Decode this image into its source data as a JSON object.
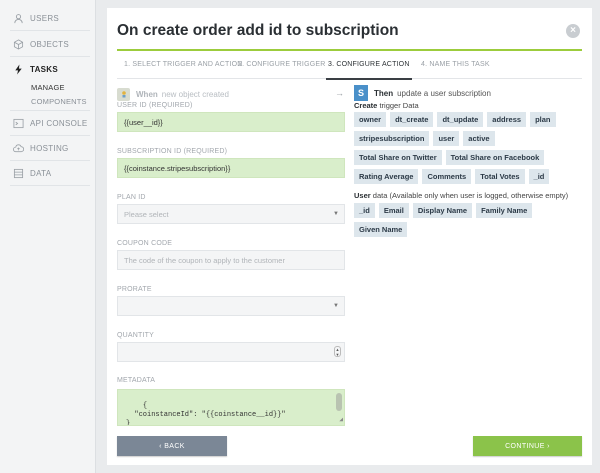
{
  "sidebar": {
    "items": [
      {
        "label": "USERS",
        "icon": "users-icon"
      },
      {
        "label": "OBJECTS",
        "icon": "cube-icon"
      },
      {
        "label": "TASKS",
        "icon": "lightning-icon"
      },
      {
        "label": "API CONSOLE",
        "icon": "terminal-icon"
      },
      {
        "label": "HOSTING",
        "icon": "cloud-icon"
      },
      {
        "label": "DATA",
        "icon": "database-icon"
      }
    ],
    "sub_items": [
      "MANAGE",
      "COMPONENTS"
    ]
  },
  "modal": {
    "title": "On create order add id to subscription",
    "close_icon": "×",
    "steps": [
      "1. SELECT TRIGGER AND ACTION",
      "2. CONFIGURE TRIGGER",
      "3. CONFIGURE ACTION",
      "4. NAME THIS TASK"
    ],
    "active_step": 2
  },
  "when": {
    "word": "When",
    "text": "new object created",
    "arrow": "→"
  },
  "form": {
    "user_id": {
      "label": "USER ID (REQUIRED)",
      "value": "{{user__id}}"
    },
    "subscription_id": {
      "label": "SUBSCRIPTION ID (REQUIRED)",
      "value": "{{coinstance.stripesubscription}}"
    },
    "plan_id": {
      "label": "PLAN ID",
      "value": "Please select"
    },
    "coupon_code": {
      "label": "COUPON CODE",
      "placeholder": "The code of the coupon to apply to the customer"
    },
    "prorate": {
      "label": "PRORATE",
      "value": ""
    },
    "quantity": {
      "label": "QUANTITY",
      "value": ""
    },
    "metadata": {
      "label": "METADATA",
      "value": "{\n  \"coinstanceId\": \"{{coinstance__id}}\"\n}"
    }
  },
  "then": {
    "icon_letter": "S",
    "word": "Then",
    "text": "update a user subscription"
  },
  "create_section": {
    "bold": "Create",
    "rest": " trigger Data",
    "tags": [
      "owner",
      "dt_create",
      "dt_update",
      "address",
      "plan",
      "stripesubscription",
      "user",
      "active",
      "Total Share on Twitter",
      "Total Share on Facebook",
      "Rating Average",
      "Comments",
      "Total Votes",
      "_id"
    ]
  },
  "user_section": {
    "bold": "User",
    "rest": " data (Available only when user is logged, otherwise empty)",
    "tags": [
      "_id",
      "Email",
      "Display Name",
      "Family Name",
      "Given Name"
    ]
  },
  "buttons": {
    "back": "‹  BACK",
    "continue": "CONTINUE  ›"
  },
  "colors": {
    "accent_green": "#8bc34a",
    "field_green": "#d9eecb",
    "back_gray": "#7b8796",
    "service_blue": "#4a90c9"
  }
}
